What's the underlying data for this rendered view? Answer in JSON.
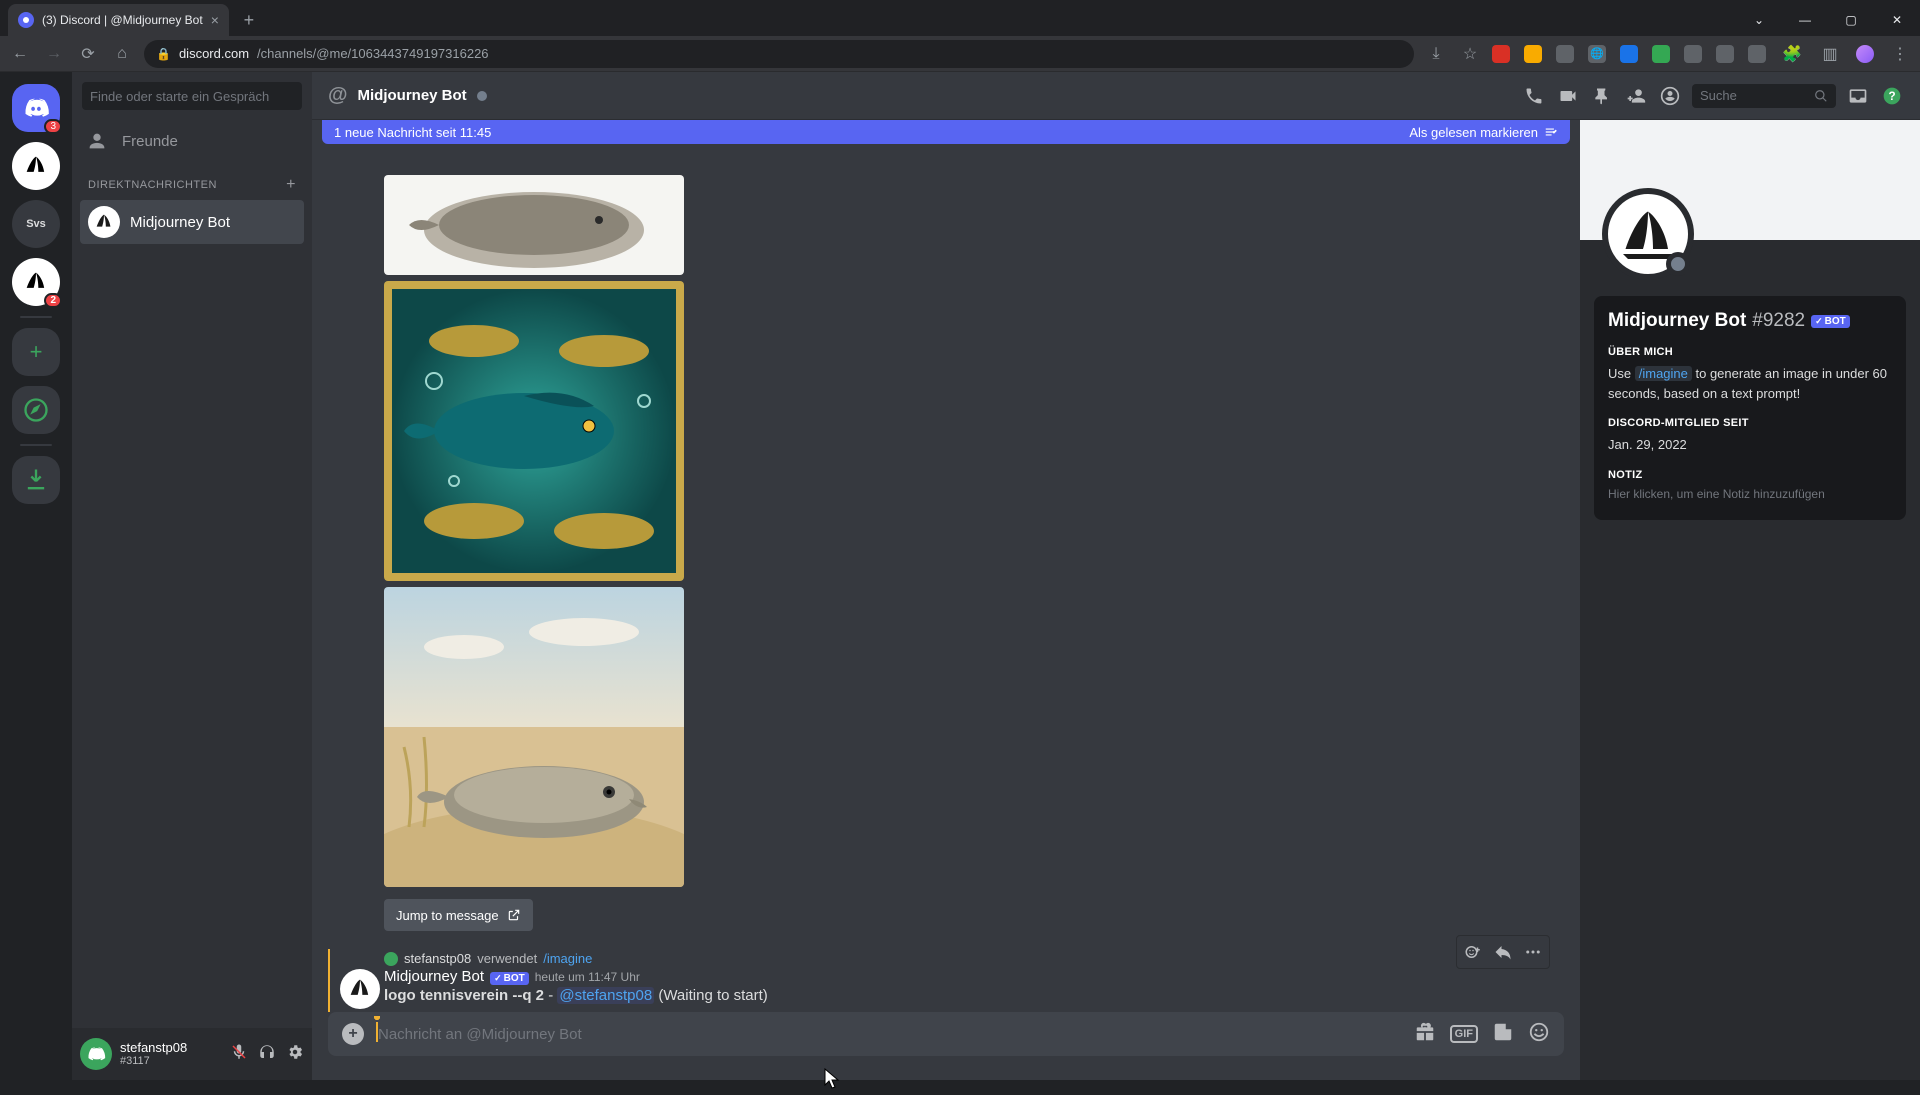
{
  "browser": {
    "tab_title": "(3) Discord | @Midjourney Bot",
    "url_host": "discord.com",
    "url_path": "/channels/@me/1063443749197316226"
  },
  "server_rail": {
    "badge_dm": "3",
    "badge_mj": "2",
    "svs_label": "Svs"
  },
  "dm_sidebar": {
    "search_placeholder": "Finde oder starte ein Gespräch",
    "friends_label": "Freunde",
    "dm_header": "DIREKTNACHRICHTEN",
    "item_mj": "Midjourney Bot"
  },
  "user_footer": {
    "username": "stefanstp08",
    "tag": "#3117"
  },
  "chat_header": {
    "title": "Midjourney Bot",
    "search_placeholder": "Suche"
  },
  "new_msg_bar": {
    "text": "1 neue Nachricht seit 11:45",
    "mark_read": "Als gelesen markieren"
  },
  "jump_label": "Jump to message",
  "message": {
    "reply_user": "stefanstp08",
    "reply_verb": "verwendet",
    "reply_cmd": "/imagine",
    "author": "Midjourney Bot",
    "bot_tag": "BOT",
    "timestamp": "heute um 11:47 Uhr",
    "prompt_bold": "logo tennisverein --q 2",
    "sep": " - ",
    "mention": "@stefanstp08",
    "waiting": " (Waiting to start)"
  },
  "compose": {
    "placeholder": "Nachricht an @Midjourney Bot",
    "gif_label": "GIF"
  },
  "profile": {
    "name": "Midjourney Bot",
    "discriminator": "#9282",
    "bot_tag": "BOT",
    "about_h": "ÜBER MICH",
    "about_pre": "Use ",
    "about_cmd": "/imagine",
    "about_post": " to generate an image in under 60 seconds, based on a text prompt!",
    "member_h": "DISCORD-MITGLIED SEIT",
    "member_date": "Jan. 29, 2022",
    "note_h": "NOTIZ",
    "note_placeholder": "Hier klicken, um eine Notiz hinzuzufügen"
  }
}
